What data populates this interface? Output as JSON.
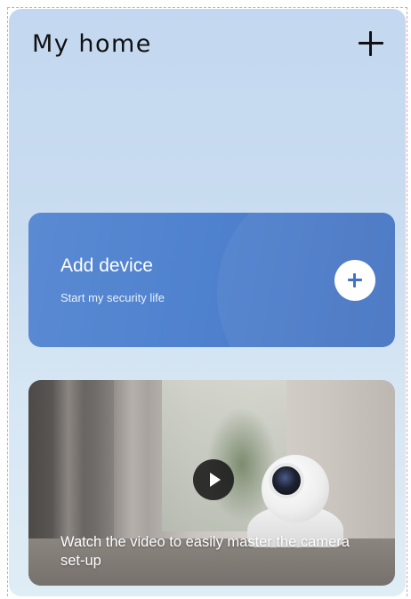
{
  "header": {
    "title": "My home",
    "add_icon": "plus-icon"
  },
  "add_device_card": {
    "title": "Add device",
    "subtitle": "Start my security life",
    "button_icon": "plus-icon",
    "accent_color": "#4f82cf"
  },
  "video_card": {
    "caption": "Watch the video to easily master the camera set-up",
    "play_icon": "play-icon"
  }
}
